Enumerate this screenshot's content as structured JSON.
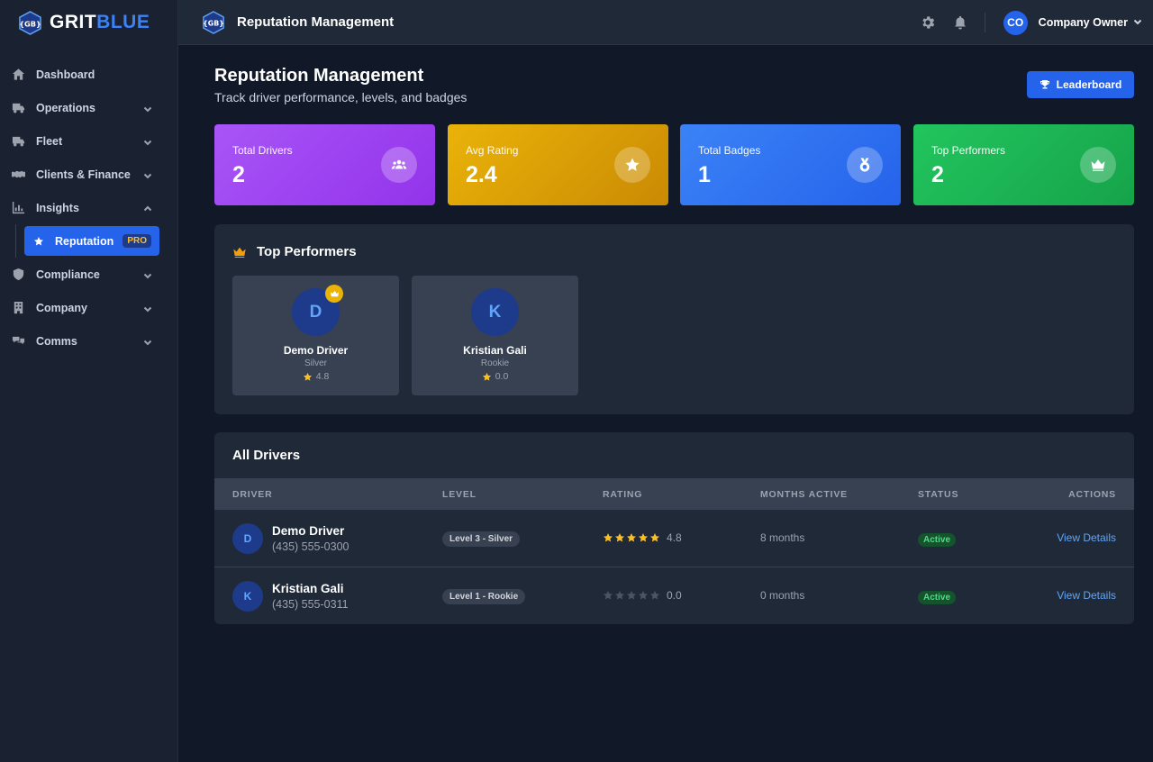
{
  "brand": {
    "mark": "{GB}",
    "name_part1": "GRIT",
    "name_part2": "BLUE",
    "accent": "#3b82f6"
  },
  "sidebar": {
    "items": [
      {
        "label": "Dashboard",
        "icon": "home-icon"
      },
      {
        "label": "Operations",
        "icon": "truck-icon"
      },
      {
        "label": "Fleet",
        "icon": "truck-icon"
      },
      {
        "label": "Clients & Finance",
        "icon": "handshake-icon"
      },
      {
        "label": "Insights",
        "icon": "chart-icon"
      },
      {
        "label": "Compliance",
        "icon": "shield-icon"
      },
      {
        "label": "Company",
        "icon": "building-icon"
      },
      {
        "label": "Comms",
        "icon": "comments-icon"
      }
    ],
    "active_sub": {
      "label": "Reputation",
      "badge": "PRO"
    }
  },
  "header": {
    "title": "Reputation Management",
    "user": {
      "initials": "CO",
      "name": "Company Owner"
    }
  },
  "page": {
    "title": "Reputation Management",
    "subtitle": "Track driver performance, levels, and badges",
    "leaderboard_label": "Leaderboard"
  },
  "stats": [
    {
      "label": "Total Drivers",
      "value": "2",
      "icon": "users-icon"
    },
    {
      "label": "Avg Rating",
      "value": "2.4",
      "icon": "star-icon"
    },
    {
      "label": "Total Badges",
      "value": "1",
      "icon": "medal-icon"
    },
    {
      "label": "Top Performers",
      "value": "2",
      "icon": "crown-icon"
    }
  ],
  "top_performers": {
    "title": "Top Performers",
    "cards": [
      {
        "initial": "D",
        "name": "Demo Driver",
        "level": "Silver",
        "rating": "4.8",
        "crown": true
      },
      {
        "initial": "K",
        "name": "Kristian Gali",
        "level": "Rookie",
        "rating": "0.0",
        "crown": false
      }
    ]
  },
  "all_drivers": {
    "title": "All Drivers",
    "columns": [
      "DRIVER",
      "LEVEL",
      "RATING",
      "MONTHS ACTIVE",
      "STATUS",
      "ACTIONS"
    ],
    "rows": [
      {
        "initial": "D",
        "name": "Demo Driver",
        "phone": "(435) 555-0300",
        "level": "Level 3 - Silver",
        "stars": 5,
        "rating": "4.8",
        "months": "8 months",
        "status": "Active",
        "action": "View Details"
      },
      {
        "initial": "K",
        "name": "Kristian Gali",
        "phone": "(435) 555-0311",
        "level": "Level 1 - Rookie",
        "stars": 0,
        "rating": "0.0",
        "months": "0 months",
        "status": "Active",
        "action": "View Details"
      }
    ]
  }
}
